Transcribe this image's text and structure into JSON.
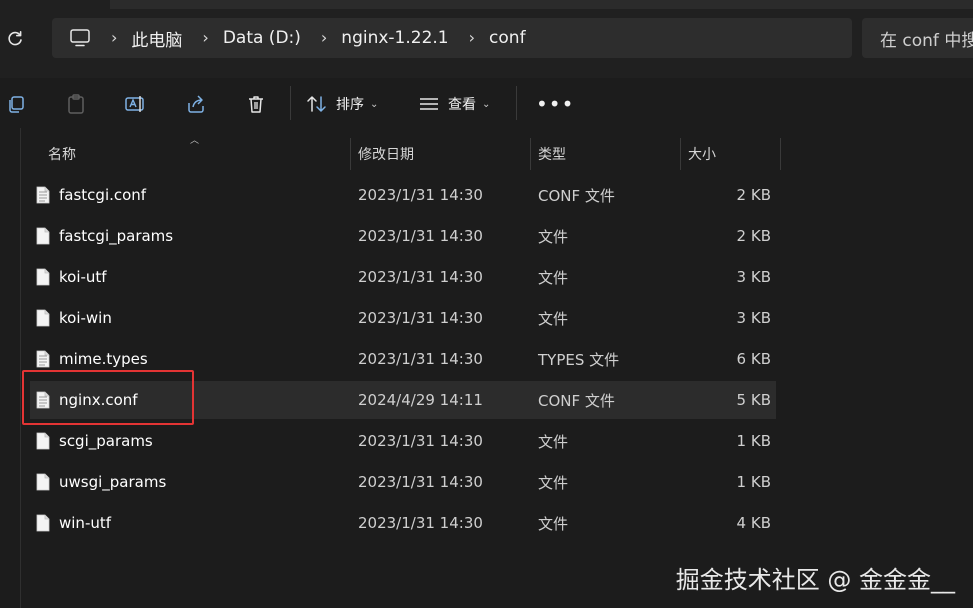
{
  "address": {
    "breadcrumbs": [
      "此电脑",
      "Data (D:)",
      "nginx-1.22.1",
      "conf"
    ],
    "search_placeholder": "在 conf 中搜"
  },
  "toolbar": {
    "sort_label": "排序",
    "view_label": "查看",
    "more_label": "•••"
  },
  "columns": {
    "name": "名称",
    "date": "修改日期",
    "type": "类型",
    "size": "大小"
  },
  "files": [
    {
      "name": "fastcgi.conf",
      "date": "2023/1/31 14:30",
      "type": "CONF 文件",
      "size": "2 KB",
      "icon": "text-file-icon"
    },
    {
      "name": "fastcgi_params",
      "date": "2023/1/31 14:30",
      "type": "文件",
      "size": "2 KB",
      "icon": "file-icon"
    },
    {
      "name": "koi-utf",
      "date": "2023/1/31 14:30",
      "type": "文件",
      "size": "3 KB",
      "icon": "file-icon"
    },
    {
      "name": "koi-win",
      "date": "2023/1/31 14:30",
      "type": "文件",
      "size": "3 KB",
      "icon": "file-icon"
    },
    {
      "name": "mime.types",
      "date": "2023/1/31 14:30",
      "type": "TYPES 文件",
      "size": "6 KB",
      "icon": "text-file-icon"
    },
    {
      "name": "nginx.conf",
      "date": "2024/4/29 14:11",
      "type": "CONF 文件",
      "size": "5 KB",
      "icon": "text-file-icon",
      "selected": true
    },
    {
      "name": "scgi_params",
      "date": "2023/1/31 14:30",
      "type": "文件",
      "size": "1 KB",
      "icon": "file-icon"
    },
    {
      "name": "uwsgi_params",
      "date": "2023/1/31 14:30",
      "type": "文件",
      "size": "1 KB",
      "icon": "file-icon"
    },
    {
      "name": "win-utf",
      "date": "2023/1/31 14:30",
      "type": "文件",
      "size": "4 KB",
      "icon": "file-icon"
    }
  ],
  "watermark": "掘金技术社区 @ 金金金__",
  "colors": {
    "highlight": "#e33434",
    "selected_row": "#2c2c2c"
  }
}
